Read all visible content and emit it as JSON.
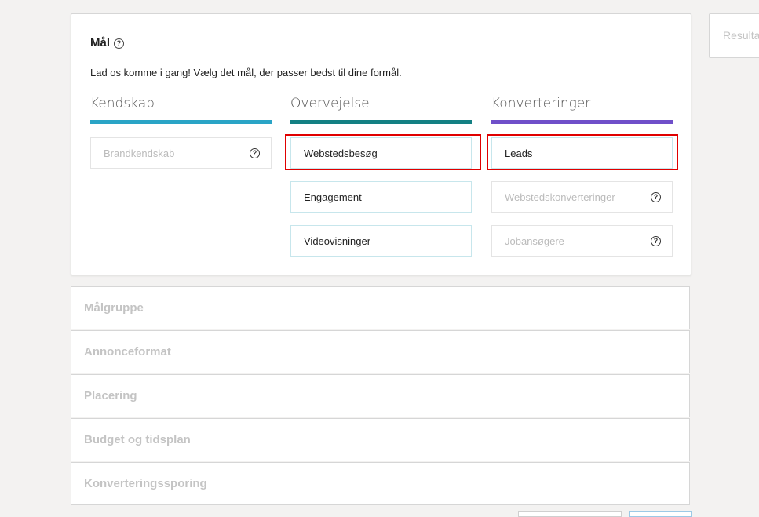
{
  "goal": {
    "title": "Mål",
    "subtitle": "Lad os komme i gang! Vælg det mål, der passer bedst til dine formål.",
    "columns": [
      {
        "heading": "Kendskab",
        "color": "#2aa4c6",
        "options": [
          {
            "label": "Brandkendskab",
            "enabled": false,
            "help": true
          }
        ]
      },
      {
        "heading": "Overvejelse",
        "color": "#138083",
        "options": [
          {
            "label": "Webstedsbesøg",
            "enabled": true,
            "help": false
          },
          {
            "label": "Engagement",
            "enabled": true,
            "help": false
          },
          {
            "label": "Videovisninger",
            "enabled": true,
            "help": false
          }
        ]
      },
      {
        "heading": "Konverteringer",
        "color": "#6f4fc9",
        "options": [
          {
            "label": "Leads",
            "enabled": true,
            "help": false
          },
          {
            "label": "Webstedskonverteringer",
            "enabled": false,
            "help": true
          },
          {
            "label": "Jobansøgere",
            "enabled": false,
            "help": true
          }
        ]
      }
    ]
  },
  "sections": [
    "Målgruppe",
    "Annonceformat",
    "Placering",
    "Budget og tidsplan",
    "Konverteringssporing"
  ],
  "side_panel": {
    "title": "Resultat"
  },
  "colors": {
    "highlight": "#e00000",
    "background": "#f3f2f1"
  }
}
